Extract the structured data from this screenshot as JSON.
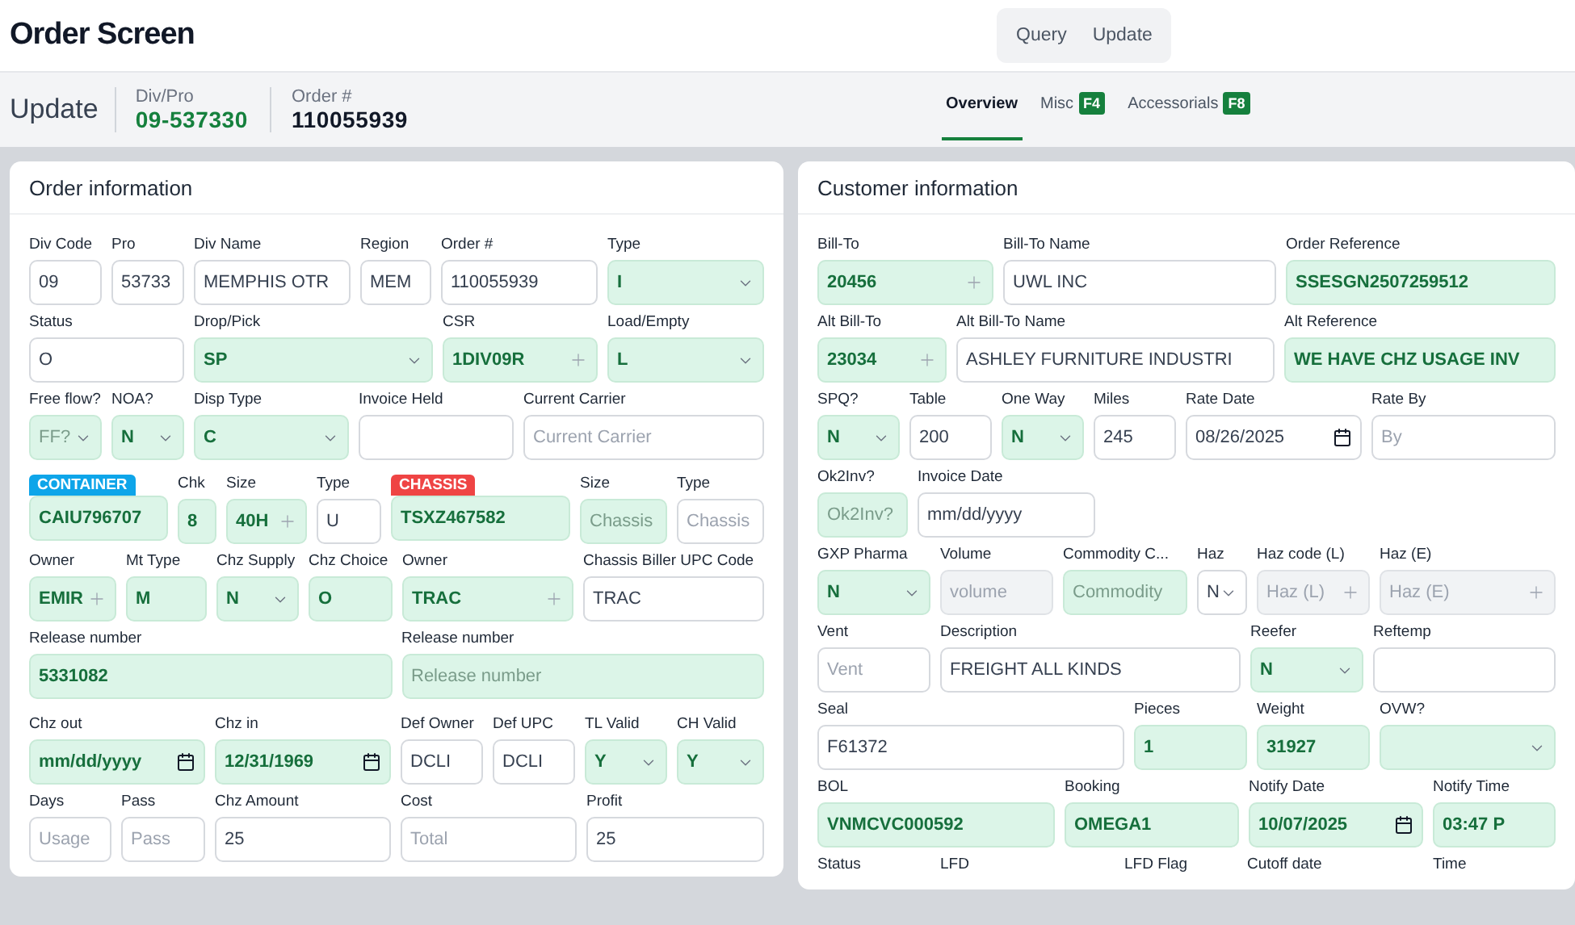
{
  "header": {
    "title": "Order Screen",
    "mode_buttons": [
      "Query",
      "Update"
    ]
  },
  "summary": {
    "mode": "Update",
    "div_pro": {
      "label": "Div/Pro",
      "value": "09-537330"
    },
    "order": {
      "label": "Order #",
      "value": "110055939"
    }
  },
  "tabs": [
    {
      "label": "Overview",
      "selected": true
    },
    {
      "label": "Misc",
      "key": "F4",
      "selected": false
    },
    {
      "label": "Accessorials",
      "key": "F8",
      "selected": false
    }
  ],
  "panels": [
    {
      "title": "Order information",
      "rows": [
        {
          "fields": [
            {
              "label": "Div Code",
              "kind": "text",
              "highlighted": false,
              "disabled": false,
              "value": "09"
            },
            {
              "label": "Pro",
              "kind": "text",
              "highlighted": false,
              "disabled": false,
              "value": "53733"
            },
            {
              "label": "Div Name",
              "kind": "text",
              "highlighted": false,
              "disabled": false,
              "value": "MEMPHIS OTR"
            },
            {
              "label": "Region",
              "kind": "text",
              "highlighted": false,
              "disabled": false,
              "value": "MEM"
            },
            {
              "label": "Order #",
              "kind": "text",
              "highlighted": false,
              "disabled": false,
              "value": "110055939"
            },
            {
              "label": "Type",
              "kind": "select",
              "highlighted": true,
              "disabled": false,
              "value": "I"
            }
          ]
        },
        {
          "fields": [
            {
              "label": "Status",
              "kind": "text",
              "highlighted": false,
              "disabled": false,
              "value": "O"
            },
            {
              "label": "Drop/Pick",
              "kind": "select",
              "highlighted": true,
              "disabled": false,
              "value": "SP"
            },
            {
              "label": "CSR",
              "kind": "lookup",
              "highlighted": true,
              "disabled": false,
              "value": "1DIV09R"
            },
            {
              "label": "Load/Empty",
              "kind": "select",
              "highlighted": true,
              "disabled": false,
              "value": "L"
            }
          ]
        },
        {
          "fields": [
            {
              "label": "Free flow?",
              "kind": "select",
              "highlighted": true,
              "disabled": false,
              "placeholder": "FF?"
            },
            {
              "label": "NOA?",
              "kind": "select",
              "highlighted": true,
              "disabled": false,
              "value": "N"
            },
            {
              "label": "Disp Type",
              "kind": "select",
              "highlighted": true,
              "disabled": false,
              "value": "C"
            },
            {
              "label": "Invoice Held",
              "kind": "text",
              "highlighted": false,
              "disabled": false
            },
            {
              "label": "Current Carrier",
              "kind": "text",
              "highlighted": false,
              "disabled": false,
              "placeholder": "Current Carrier"
            }
          ]
        },
        {
          "fields": [
            {
              "label": "CONTAINER",
              "color": "#0ea5e9",
              "kind": "text",
              "highlighted": true,
              "disabled": false,
              "value": "CAIU796707"
            },
            {
              "label": "Chk",
              "kind": "text",
              "highlighted": true,
              "disabled": false,
              "value": "8"
            },
            {
              "label": "Size",
              "kind": "lookup",
              "highlighted": true,
              "disabled": false,
              "value": "40H"
            },
            {
              "label": "Type",
              "kind": "text",
              "highlighted": false,
              "disabled": false,
              "value": "U"
            },
            {
              "label": "CHASSIS",
              "color": "#ef4444",
              "kind": "text",
              "highlighted": true,
              "disabled": false,
              "value": "TSXZ467582"
            },
            {
              "label": "Size",
              "kind": "text",
              "highlighted": true,
              "disabled": false,
              "placeholder": "Chassis"
            },
            {
              "label": "Type",
              "kind": "text",
              "highlighted": false,
              "disabled": false,
              "placeholder": "Chassis"
            }
          ]
        },
        {
          "fields": [
            {
              "label": "Owner",
              "kind": "lookup",
              "highlighted": true,
              "disabled": false,
              "value": "EMIR"
            },
            {
              "label": "Mt Type",
              "kind": "text",
              "highlighted": true,
              "disabled": false,
              "value": "M"
            },
            {
              "label": "Chz Supply",
              "kind": "select",
              "highlighted": true,
              "disabled": false,
              "value": "N"
            },
            {
              "label": "Chz Choice",
              "kind": "text",
              "highlighted": true,
              "disabled": false,
              "value": "O"
            },
            {
              "label": "Owner",
              "kind": "lookup",
              "highlighted": true,
              "disabled": false,
              "value": "TRAC"
            },
            {
              "label": "Chassis Biller UPC Code",
              "kind": "text",
              "highlighted": false,
              "disabled": false,
              "value": "TRAC"
            }
          ]
        },
        {
          "fields": [
            {
              "label": "Release number",
              "kind": "text",
              "highlighted": true,
              "disabled": false,
              "value": "5331082"
            },
            {
              "label": "Release number",
              "kind": "text",
              "highlighted": true,
              "disabled": false,
              "placeholder": "Release number"
            }
          ]
        },
        {
          "fields": [
            {
              "label": "Chz out",
              "kind": "date",
              "highlighted": true,
              "disabled": false,
              "value": "mm/dd/yyyy"
            },
            {
              "label": "Chz in",
              "kind": "date",
              "highlighted": true,
              "disabled": false,
              "value": "12/31/1969"
            },
            {
              "label": "Def Owner",
              "kind": "text",
              "highlighted": false,
              "disabled": false,
              "value": "DCLI"
            },
            {
              "label": "Def UPC",
              "kind": "text",
              "highlighted": false,
              "disabled": false,
              "value": "DCLI"
            },
            {
              "label": "TL Valid",
              "kind": "select",
              "highlighted": true,
              "disabled": false,
              "value": "Y"
            },
            {
              "label": "CH Valid",
              "kind": "select",
              "highlighted": true,
              "disabled": false,
              "value": "Y"
            }
          ]
        },
        {
          "fields": [
            {
              "label": "Days",
              "kind": "text",
              "highlighted": false,
              "disabled": false,
              "placeholder": "Usage"
            },
            {
              "label": "Pass",
              "kind": "text",
              "highlighted": false,
              "disabled": false,
              "placeholder": "Pass"
            },
            {
              "label": "Chz Amount",
              "kind": "text",
              "highlighted": false,
              "disabled": false,
              "value": "25"
            },
            {
              "label": "Cost",
              "kind": "text",
              "highlighted": false,
              "disabled": false,
              "placeholder": "Total"
            },
            {
              "label": "Profit",
              "kind": "text",
              "highlighted": false,
              "disabled": false,
              "value": "25"
            }
          ]
        }
      ]
    },
    {
      "title": "Customer information",
      "rows": [
        {
          "fields": [
            {
              "label": "Bill-To",
              "kind": "lookup",
              "highlighted": true,
              "disabled": false,
              "value": "20456"
            },
            {
              "label": "Bill-To Name",
              "kind": "text",
              "highlighted": false,
              "disabled": false,
              "value": "UWL INC"
            },
            {
              "label": "Order Reference",
              "kind": "text",
              "highlighted": true,
              "disabled": false,
              "value": "SSESGN2507259512"
            }
          ]
        },
        {
          "fields": [
            {
              "label": "Alt Bill-To",
              "kind": "lookup",
              "highlighted": true,
              "disabled": false,
              "value": "23034"
            },
            {
              "label": "Alt Bill-To Name",
              "kind": "text",
              "highlighted": false,
              "disabled": false,
              "value": "ASHLEY FURNITURE INDUSTRI"
            },
            {
              "label": "Alt Reference",
              "kind": "text",
              "highlighted": true,
              "disabled": false,
              "value": "WE HAVE CHZ USAGE INV"
            }
          ]
        },
        {
          "fields": [
            {
              "label": "SPQ?",
              "kind": "select",
              "highlighted": true,
              "disabled": false,
              "value": "N"
            },
            {
              "label": "Table",
              "kind": "text",
              "highlighted": false,
              "disabled": false,
              "value": "200"
            },
            {
              "label": "One Way",
              "kind": "select",
              "highlighted": true,
              "disabled": false,
              "value": "N"
            },
            {
              "label": "Miles",
              "kind": "text",
              "highlighted": false,
              "disabled": false,
              "value": "245"
            },
            {
              "label": "Rate Date",
              "kind": "date",
              "highlighted": false,
              "disabled": false,
              "value": "08/26/2025"
            },
            {
              "label": "Rate By",
              "kind": "text",
              "highlighted": false,
              "disabled": false,
              "placeholder": "By"
            }
          ]
        },
        {
          "fields": [
            {
              "label": "Ok2Inv?",
              "kind": "text",
              "highlighted": true,
              "disabled": false,
              "placeholder": "Ok2Inv?"
            },
            {
              "label": "Invoice Date",
              "kind": "text",
              "highlighted": false,
              "disabled": false,
              "value": "mm/dd/yyyy"
            }
          ]
        },
        {
          "fields": [
            {
              "label": "GXP Pharma",
              "kind": "select",
              "highlighted": true,
              "disabled": false,
              "value": "N"
            },
            {
              "label": "Volume",
              "kind": "text",
              "highlighted": false,
              "disabled": true,
              "placeholder": "volume"
            },
            {
              "label": "Commodity C...",
              "kind": "text",
              "highlighted": true,
              "disabled": false,
              "placeholder": "Commodity"
            },
            {
              "label": "Haz",
              "kind": "select",
              "highlighted": false,
              "disabled": false,
              "value": "N"
            },
            {
              "label": "Haz code (L)",
              "kind": "lookup",
              "highlighted": false,
              "disabled": true,
              "placeholder": "Haz (L)"
            },
            {
              "label": "Haz (E)",
              "kind": "lookup",
              "highlighted": false,
              "disabled": true,
              "placeholder": "Haz (E)"
            }
          ]
        },
        {
          "fields": [
            {
              "label": "Vent",
              "kind": "text",
              "highlighted": false,
              "disabled": false,
              "placeholder": "Vent"
            },
            {
              "label": "Description",
              "kind": "text",
              "highlighted": false,
              "disabled": false,
              "value": "FREIGHT ALL KINDS"
            },
            {
              "label": "Reefer",
              "kind": "select",
              "highlighted": true,
              "disabled": false,
              "value": "N"
            },
            {
              "label": "Reftemp",
              "kind": "text",
              "highlighted": false,
              "disabled": false
            }
          ]
        },
        {
          "fields": [
            {
              "label": "Seal",
              "kind": "text",
              "highlighted": false,
              "disabled": false,
              "value": "F61372"
            },
            {
              "label": "Pieces",
              "kind": "text",
              "highlighted": true,
              "disabled": false,
              "value": "1"
            },
            {
              "label": "Weight",
              "kind": "text",
              "highlighted": true,
              "disabled": false,
              "value": "31927"
            },
            {
              "label": "OVW?",
              "kind": "select",
              "highlighted": true,
              "disabled": false
            }
          ]
        },
        {
          "fields": [
            {
              "label": "BOL",
              "kind": "text",
              "highlighted": true,
              "disabled": false,
              "value": "VNMCVC000592"
            },
            {
              "label": "Booking",
              "kind": "text",
              "highlighted": true,
              "disabled": false,
              "value": "OMEGA1"
            },
            {
              "label": "Notify Date",
              "kind": "date",
              "highlighted": true,
              "disabled": false,
              "value": "10/07/2025"
            },
            {
              "label": "Notify Time",
              "kind": "text",
              "highlighted": true,
              "disabled": false,
              "value": "03:47 P"
            }
          ]
        },
        {
          "fields": [
            {
              "label": "Status",
              "kind": "label"
            },
            {
              "label": "LFD",
              "kind": "label"
            },
            {
              "label": "LFD Flag",
              "kind": "label"
            },
            {
              "label": "Cutoff date",
              "kind": "label"
            },
            {
              "label": "Time",
              "kind": "label"
            }
          ]
        }
      ]
    }
  ]
}
